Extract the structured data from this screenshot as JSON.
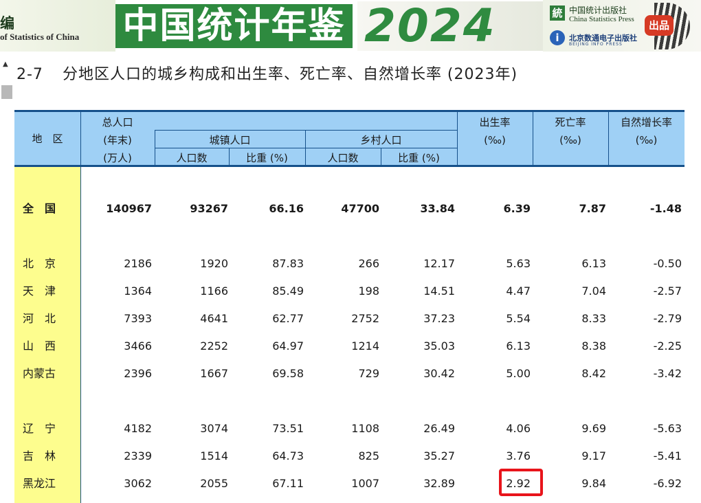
{
  "banner": {
    "left_top": "编",
    "left_bottom": "of Statistics of China",
    "title": "中国统计年鉴",
    "year": "2024",
    "press_cn": "中国统计出版社",
    "press_en": "China Statistics Press",
    "press2_cn": "北京数通电子出版社",
    "press2_en": "BEIJING INFO PRESS",
    "stamp": "出品"
  },
  "table": {
    "title_num": "2-7",
    "title_text": "分地区人口的城乡构成和出生率、死亡率、自然增长率 (2023年)",
    "headers": {
      "region": "地　区",
      "total_1": "总人口",
      "total_2": "(年末)",
      "total_3": "(万人)",
      "urban": "城镇人口",
      "rural": "乡村人口",
      "pop_count": "人口数",
      "share": "比重 (%)",
      "birth": "出生率",
      "death": "死亡率",
      "natural": "自然增长率",
      "permille": "(‰)"
    },
    "rows": [
      {
        "region": "全　国",
        "total": "140967",
        "urban_pop": "93267",
        "urban_share": "66.16",
        "rural_pop": "47700",
        "rural_share": "33.84",
        "birth": "6.39",
        "death": "7.87",
        "natural": "-1.48"
      },
      {
        "region": "北　京",
        "total": "2186",
        "urban_pop": "1920",
        "urban_share": "87.83",
        "rural_pop": "266",
        "rural_share": "12.17",
        "birth": "5.63",
        "death": "6.13",
        "natural": "-0.50"
      },
      {
        "region": "天　津",
        "total": "1364",
        "urban_pop": "1166",
        "urban_share": "85.49",
        "rural_pop": "198",
        "rural_share": "14.51",
        "birth": "4.47",
        "death": "7.04",
        "natural": "-2.57"
      },
      {
        "region": "河　北",
        "total": "7393",
        "urban_pop": "4641",
        "urban_share": "62.77",
        "rural_pop": "2752",
        "rural_share": "37.23",
        "birth": "5.54",
        "death": "8.33",
        "natural": "-2.79"
      },
      {
        "region": "山　西",
        "total": "3466",
        "urban_pop": "2252",
        "urban_share": "64.97",
        "rural_pop": "1214",
        "rural_share": "35.03",
        "birth": "6.13",
        "death": "8.38",
        "natural": "-2.25"
      },
      {
        "region": "内蒙古",
        "total": "2396",
        "urban_pop": "1667",
        "urban_share": "69.58",
        "rural_pop": "729",
        "rural_share": "30.42",
        "birth": "5.00",
        "death": "8.42",
        "natural": "-3.42"
      },
      {
        "region": "辽　宁",
        "total": "4182",
        "urban_pop": "3074",
        "urban_share": "73.51",
        "rural_pop": "1108",
        "rural_share": "26.49",
        "birth": "4.06",
        "death": "9.69",
        "natural": "-5.63"
      },
      {
        "region": "吉　林",
        "total": "2339",
        "urban_pop": "1514",
        "urban_share": "64.73",
        "rural_pop": "825",
        "rural_share": "35.27",
        "birth": "3.76",
        "death": "9.17",
        "natural": "-5.41"
      },
      {
        "region": "黑龙江",
        "total": "3062",
        "urban_pop": "2055",
        "urban_share": "67.11",
        "rural_pop": "1007",
        "rural_share": "32.89",
        "birth": "2.92",
        "death": "9.84",
        "natural": "-6.92"
      }
    ]
  },
  "colors": {
    "header_bg": "#9fd0f5",
    "region_bg": "#fdfd8e",
    "rule": "#15508a",
    "highlight": "#e8141b",
    "banner_green": "#2e8a3f"
  }
}
